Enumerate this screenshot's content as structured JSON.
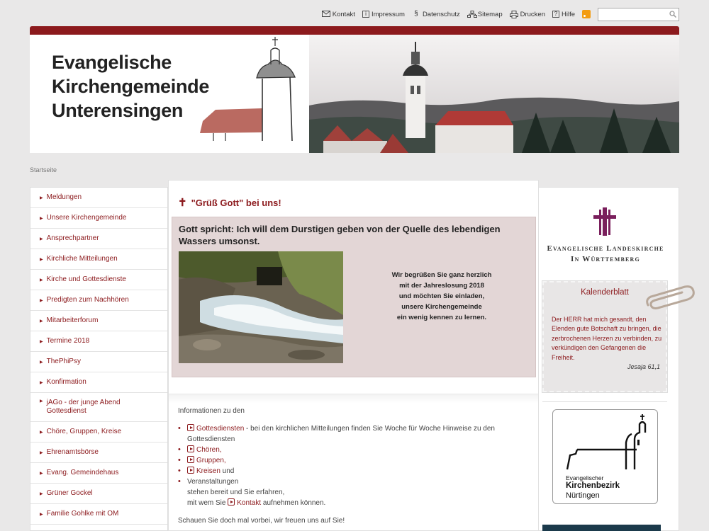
{
  "topnav": {
    "kontakt": "Kontakt",
    "impressum": "Impressum",
    "datenschutz": "Datenschutz",
    "sitemap": "Sitemap",
    "drucken": "Drucken",
    "hilfe": "Hilfe",
    "search_value": ""
  },
  "banner": {
    "line1": "Evangelische",
    "line2": "Kirchengemeinde",
    "line3": "Unterensingen"
  },
  "breadcrumb": "Startseite",
  "nav": [
    {
      "label": "Meldungen"
    },
    {
      "label": "Unsere Kirchengemeinde"
    },
    {
      "label": "Ansprechpartner"
    },
    {
      "label": "Kirchliche Mitteilungen"
    },
    {
      "label": "Kirche und Gottesdienste"
    },
    {
      "label": "Predigten zum Nachhören"
    },
    {
      "label": "Mitarbeiterforum"
    },
    {
      "label": "Termine 2018"
    },
    {
      "label": "ThePhiPsy"
    },
    {
      "label": "Konfirmation"
    },
    {
      "label": "jAGo - der junge Abend Gottesdienst"
    },
    {
      "label": "Chöre, Gruppen, Kreise"
    },
    {
      "label": "Ehrenamtsbörse"
    },
    {
      "label": "Evang. Gemeindehaus"
    },
    {
      "label": "Grüner Gockel"
    },
    {
      "label": "Familie Gohlke mit OM"
    }
  ],
  "main": {
    "headline": "\"Grüß Gott\" bei uns!",
    "quote": "Gott spricht: Ich will dem Durstigen geben von der Quelle des lebendigen Wassers umsonst.",
    "welcome": "Wir begrüßen Sie ganz herzlich\nmit der Jahreslosung 2018\nund möchten Sie einladen,\nunsere Kirchengemeinde\nein wenig kennen zu lernen.",
    "info_intro": "Informationen zu den",
    "gottesdienste_link": "Gottesdiensten",
    "gottesdienste_rest": " - bei den kirchlichen Mitteilungen finden Sie Woche für Woche Hinweise zu den Gottesdiensten",
    "choere_link": "Chören,",
    "gruppen_link": "Gruppen,",
    "kreisen_link": "Kreisen",
    "kreisen_rest": " und",
    "veranstaltungen": "Veranstaltungen",
    "stehen": "stehen bereit und Sie erfahren,",
    "mit_wem": "mit wem Sie ",
    "kontakt_link": "Kontakt",
    "aufnehmen": " aufnehmen können.",
    "closing": "Schauen Sie doch mal vorbei, wir freuen uns auf Sie!"
  },
  "right": {
    "landeskirche": "Evangelische Landeskirche\nIn Württemberg",
    "kalender_title": "Kalenderblatt",
    "kalender_text": "Der HERR hat mich gesandt, den Elenden gute Botschaft zu bringen, die zerbrochenen Herzen zu verbinden, zu verkündigen den Gefangenen die Freiheit.",
    "kalender_source": "Jesaja 61,1",
    "kb1": "Evangelischer",
    "kb2": "Kirchenbezirk",
    "kb3": "Nürtingen"
  },
  "colors": {
    "accent": "#8c1a1d",
    "quote_bg": "#e3d6d6",
    "page_bg": "#e9e8e8"
  }
}
